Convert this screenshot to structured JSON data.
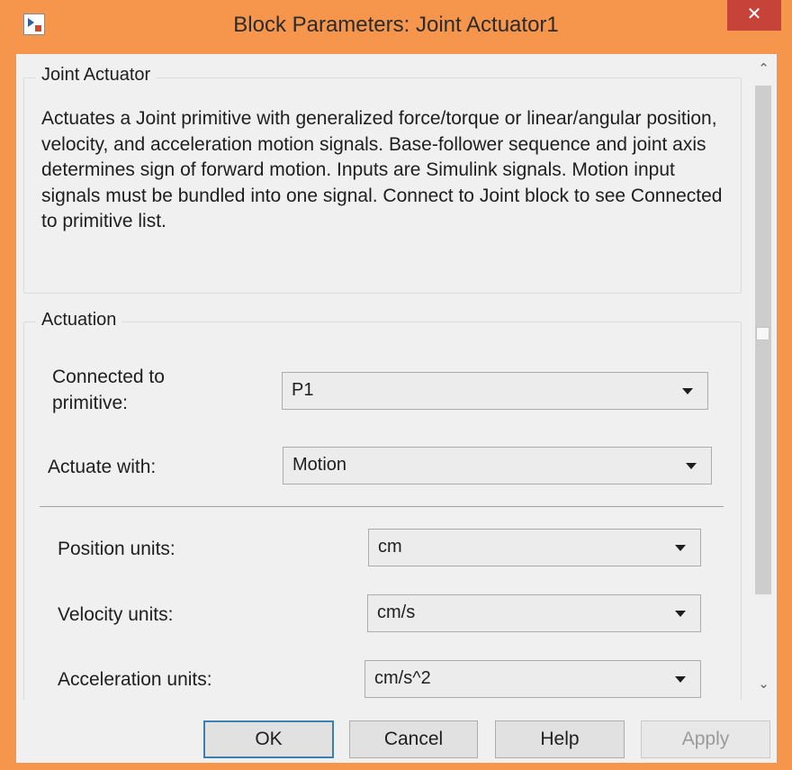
{
  "window": {
    "title": "Block Parameters: Joint Actuator1",
    "close_glyph": "✕",
    "app_icon": "simulink-block-icon"
  },
  "description_group": {
    "legend": "Joint Actuator",
    "text": "Actuates a Joint primitive with generalized force/torque or linear/angular position, velocity, and acceleration motion signals. Base-follower sequence and joint axis determines sign of forward motion. Inputs are Simulink signals. Motion input signals must be bundled into one signal. Connect to Joint block to see Connected to primitive list."
  },
  "actuation_group": {
    "legend": "Actuation",
    "connected_to_primitive": {
      "label_line1": "Connected to",
      "label_line2": "primitive:",
      "value": "P1"
    },
    "actuate_with": {
      "label": "Actuate with:",
      "value": "Motion"
    },
    "position_units": {
      "label": "Position units:",
      "value": "cm"
    },
    "velocity_units": {
      "label": "Velocity units:",
      "value": "cm/s"
    },
    "acceleration_units": {
      "label": "Acceleration units:",
      "value": "cm/s^2"
    }
  },
  "scrollbar": {
    "up_glyph": "⌃",
    "down_glyph": "⌄"
  },
  "buttons": {
    "ok": "OK",
    "cancel": "Cancel",
    "help": "Help",
    "apply": "Apply"
  },
  "colors": {
    "window_frame": "#f6964d",
    "close_button": "#c7433a",
    "dialog_background": "#f0f0f0",
    "default_button_border": "#3c7fb1"
  }
}
